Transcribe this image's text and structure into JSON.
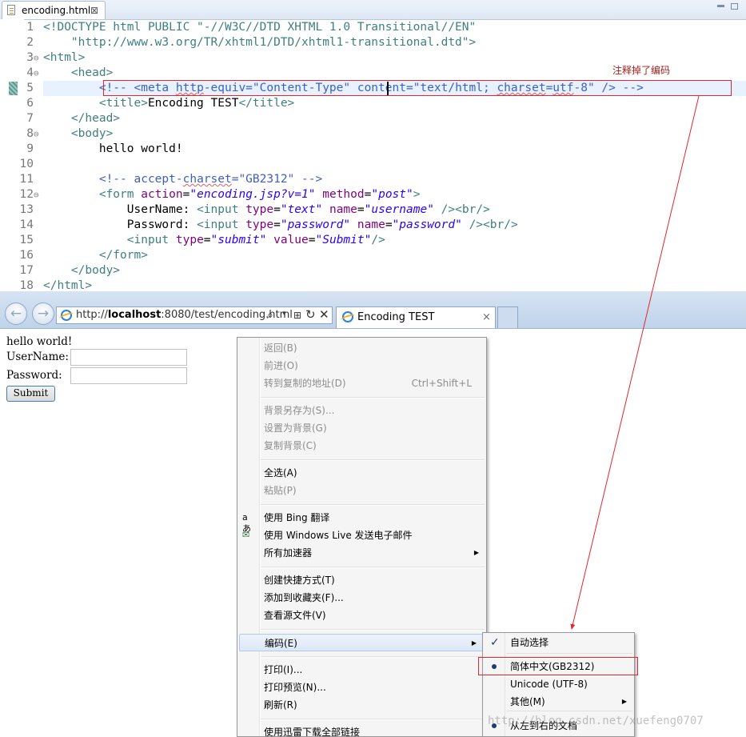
{
  "editor": {
    "tab_title": "encoding.html",
    "tab_close": "⊠",
    "lines": [
      {
        "num": "1",
        "fold": ""
      },
      {
        "num": "2",
        "fold": ""
      },
      {
        "num": "3",
        "fold": "⊖"
      },
      {
        "num": "4",
        "fold": "⊖"
      },
      {
        "num": "5",
        "fold": ""
      },
      {
        "num": "6",
        "fold": ""
      },
      {
        "num": "7",
        "fold": ""
      },
      {
        "num": "8",
        "fold": "⊖"
      },
      {
        "num": "9",
        "fold": ""
      },
      {
        "num": "10",
        "fold": ""
      },
      {
        "num": "11",
        "fold": ""
      },
      {
        "num": "12",
        "fold": "⊖"
      },
      {
        "num": "13",
        "fold": ""
      },
      {
        "num": "14",
        "fold": ""
      },
      {
        "num": "15",
        "fold": ""
      },
      {
        "num": "16",
        "fold": ""
      },
      {
        "num": "17",
        "fold": ""
      },
      {
        "num": "18",
        "fold": ""
      }
    ],
    "code": {
      "l1": "<!DOCTYPE html PUBLIC \"-//W3C//DTD XHTML 1.0 Transitional//EN\"",
      "l2": "    \"http://www.w3.org/TR/xhtml1/DTD/xhtml1-transitional.dtd\">",
      "l5_indent": "        ",
      "l5": "<!-- <meta http-equiv=\"Content-Type\" content=\"text/html; charset=utf-8\" /> -->",
      "l9": "        hello world!",
      "l11_indent": "        ",
      "l11": "<!-- accept-charset=\"GB2312\" -->"
    },
    "annotation": "注释掉了编码"
  },
  "browser": {
    "url_prefix": "http://",
    "url_host": "localhost",
    "url_rest": ":8080/test/encoding.html",
    "search_icon": "⌕",
    "dropdown_icon": "▾",
    "compat_icon": "⊞",
    "refresh_icon": "↻",
    "stop_icon": "✕",
    "back_icon": "←",
    "forward_icon": "→",
    "tab_title": "Encoding TEST",
    "tab_close": "×"
  },
  "page": {
    "hello": "hello world!",
    "username_label": "UserName:",
    "password_label": "Password:",
    "submit_label": "Submit"
  },
  "context_menu": {
    "items": [
      {
        "label": "返回(B)",
        "shortcut": ""
      },
      {
        "label": "前进(O)",
        "shortcut": ""
      },
      {
        "label": "转到复制的地址(D)",
        "shortcut": "Ctrl+Shift+L"
      },
      {
        "label": "背景另存为(S)...",
        "shortcut": ""
      },
      {
        "label": "设置为背景(G)",
        "shortcut": ""
      },
      {
        "label": "复制背景(C)",
        "shortcut": ""
      },
      {
        "label": "全选(A)",
        "shortcut": ""
      },
      {
        "label": "粘贴(P)",
        "shortcut": ""
      },
      {
        "label": "使用 Bing 翻译",
        "shortcut": ""
      },
      {
        "label": "使用 Windows Live 发送电子邮件",
        "shortcut": ""
      },
      {
        "label": "所有加速器",
        "shortcut": ""
      },
      {
        "label": "创建快捷方式(T)",
        "shortcut": ""
      },
      {
        "label": "添加到收藏夹(F)...",
        "shortcut": ""
      },
      {
        "label": "查看源文件(V)",
        "shortcut": ""
      },
      {
        "label": "编码(E)",
        "shortcut": ""
      },
      {
        "label": "打印(I)...",
        "shortcut": ""
      },
      {
        "label": "打印预览(N)...",
        "shortcut": ""
      },
      {
        "label": "刷新(R)",
        "shortcut": ""
      },
      {
        "label": "使用迅雷下载全部链接",
        "shortcut": ""
      }
    ],
    "submenu_arrow": "▶",
    "bing_icon": "aあ",
    "live_icon": "✉"
  },
  "encoding_submenu": {
    "items": [
      {
        "label": "自动选择"
      },
      {
        "label": "简体中文(GB2312)"
      },
      {
        "label": "Unicode (UTF-8)"
      },
      {
        "label": "其他(M)"
      },
      {
        "label": "从左到右的文档"
      }
    ],
    "check_mark": "✓"
  },
  "watermark": "http://blog.csdn.net/xuefeng0707",
  "colors": {
    "annotation_red": "#e0262f",
    "tag": "#3f7f7f",
    "attr_name": "#7f007f",
    "attr_value": "#2a00ff",
    "comment": "#3f5fbf"
  }
}
